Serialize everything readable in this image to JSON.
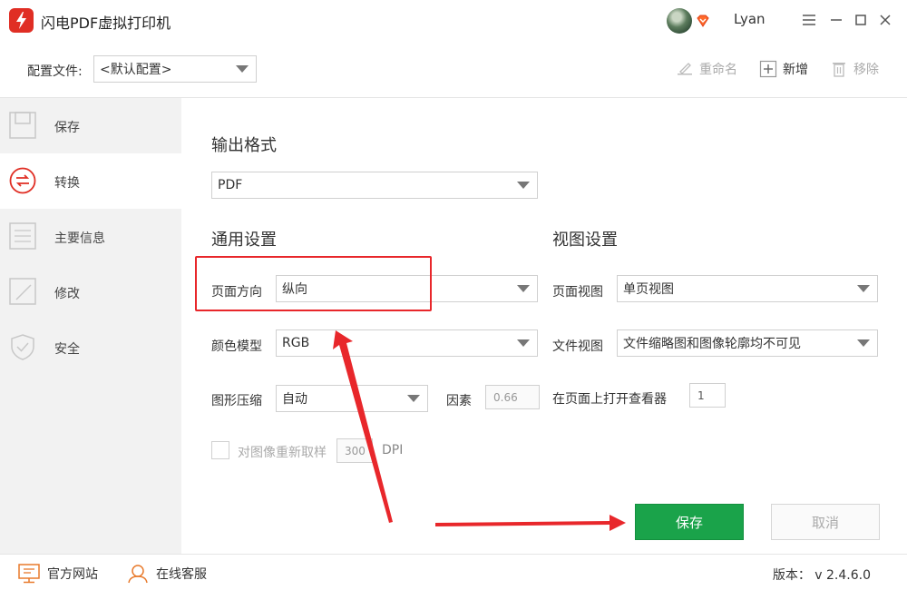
{
  "app": {
    "title": "闪电PDF虚拟打印机",
    "username": "Lyan"
  },
  "config": {
    "label": "配置文件:",
    "selected": "<默认配置>",
    "rename": "重命名",
    "add": "新增",
    "remove": "移除"
  },
  "sidebar": {
    "items": [
      {
        "label": "保存",
        "icon": "save-icon"
      },
      {
        "label": "转换",
        "icon": "convert-icon"
      },
      {
        "label": "主要信息",
        "icon": "info-icon"
      },
      {
        "label": "修改",
        "icon": "edit-icon"
      },
      {
        "label": "安全",
        "icon": "shield-icon"
      }
    ],
    "active_index": 1
  },
  "main": {
    "output_title": "输出格式",
    "output_value": "PDF",
    "general_title": "通用设置",
    "view_title": "视图设置",
    "orientation_label": "页面方向",
    "orientation_value": "纵向",
    "color_label": "颜色模型",
    "color_value": "RGB",
    "compress_label": "图形压缩",
    "compress_value": "自动",
    "factor_label": "因素",
    "factor_value": "0.66",
    "resample_label": "对图像重新取样",
    "resample_value": "300",
    "resample_unit": "DPI",
    "page_view_label": "页面视图",
    "page_view_value": "单页视图",
    "doc_view_label": "文件视图",
    "doc_view_value": "文件缩略图和图像轮廓均不可见",
    "open_page_label": "在页面上打开查看器",
    "open_page_value": "1"
  },
  "buttons": {
    "save": "保存",
    "cancel": "取消"
  },
  "footer": {
    "website": "官方网站",
    "support": "在线客服",
    "version": "版本： v 2.4.6.0"
  },
  "colors": {
    "accent": "#1aa34a",
    "annotation": "#e8272b",
    "brand": "#e02e24"
  }
}
